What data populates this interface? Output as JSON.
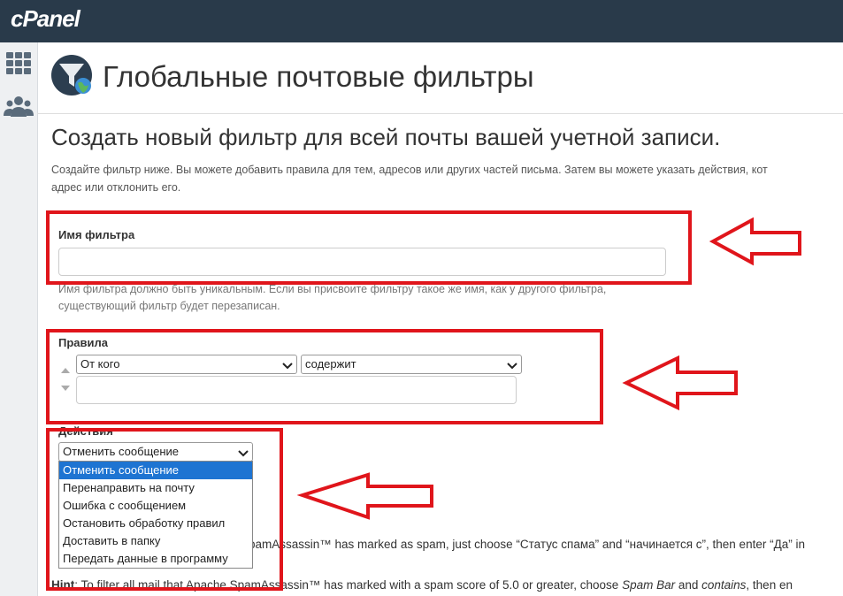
{
  "brand": {
    "logo_text": "cPanel"
  },
  "sidebar": {
    "items": [
      {
        "icon": "grid-icon"
      },
      {
        "icon": "users-icon"
      }
    ]
  },
  "header": {
    "title": "Глобальные почтовые фильтры",
    "icon": "filter-globe-icon"
  },
  "section": {
    "title": "Создать новый фильтр для всей почты вашей учетной записи.",
    "description_line1": "Создайте фильтр ниже. Вы можете добавить правила для тем, адресов или других частей письма. Затем вы можете указать действия, кот",
    "description_line2": "адрес или отклонить его."
  },
  "filter_name": {
    "label": "Имя фильтра",
    "value": "",
    "help_line1": "Имя фильтра должно быть уникальным. Если вы присвоите фильтру такое же имя, как у другого фильтра,",
    "help_line2": "существующий фильтр будет перезаписан."
  },
  "rules": {
    "label": "Правила",
    "field_select": "От кого",
    "operator_select": "содержит",
    "value": ""
  },
  "actions": {
    "label": "Действия",
    "selected": "Отменить сообщение",
    "options": [
      "Отменить сообщение",
      "Перенаправить на почту",
      "Ошибка с сообщением",
      "Остановить обработку правил",
      "Доставить в папку",
      "Передать данные в программу"
    ]
  },
  "hints": {
    "hint1_visible": "SpamAssassin™ has marked as spam, just choose “Статус спама” and “начинается с”, then enter “Да” in",
    "hint2_prefix": "Hint",
    "hint2_text": ": To filter all mail that Apache SpamAssassin™ has marked with a spam score of 5.0 or greater, choose ",
    "hint2_em1": "Spam Bar",
    "hint2_mid": " and ",
    "hint2_em2": "contains",
    "hint2_end": ", then en"
  },
  "colors": {
    "topbar": "#293a4a",
    "annotation": "#e0151b",
    "selected_option": "#1e74d2"
  }
}
